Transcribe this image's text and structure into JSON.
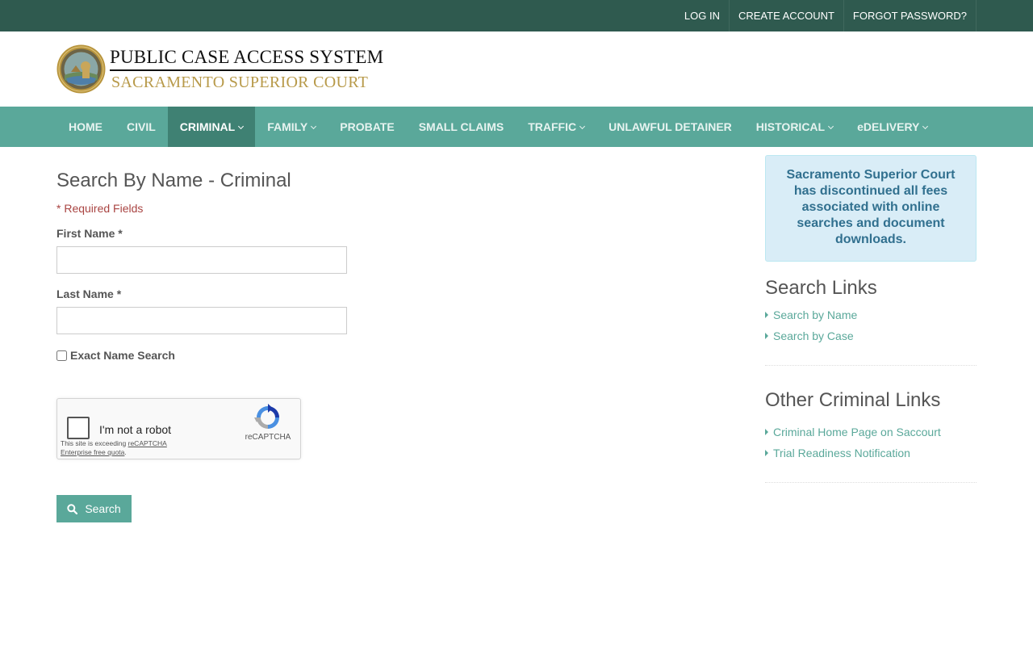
{
  "topbar": {
    "links": [
      "LOG IN",
      "CREATE ACCOUNT",
      "FORGOT PASSWORD?"
    ]
  },
  "header": {
    "title_line1": "PUBLIC CASE ACCESS SYSTEM",
    "title_line2": "SACRAMENTO SUPERIOR COURT"
  },
  "nav": {
    "items": [
      {
        "label": "HOME",
        "dropdown": false,
        "active": false
      },
      {
        "label": "CIVIL",
        "dropdown": false,
        "active": false
      },
      {
        "label": "CRIMINAL",
        "dropdown": true,
        "active": true
      },
      {
        "label": "FAMILY",
        "dropdown": true,
        "active": false
      },
      {
        "label": "PROBATE",
        "dropdown": false,
        "active": false
      },
      {
        "label": "SMALL CLAIMS",
        "dropdown": false,
        "active": false
      },
      {
        "label": "TRAFFIC",
        "dropdown": true,
        "active": false
      },
      {
        "label": "UNLAWFUL DETAINER",
        "dropdown": false,
        "active": false
      },
      {
        "label": "HISTORICAL",
        "dropdown": true,
        "active": false
      },
      {
        "label": "eDELIVERY",
        "dropdown": true,
        "active": false
      }
    ]
  },
  "form": {
    "title": "Search By Name - Criminal",
    "required_note": "* Required Fields",
    "first_name_label": "First Name *",
    "first_name_value": "",
    "last_name_label": "Last Name *",
    "last_name_value": "",
    "exact_label": "Exact Name Search",
    "exact_checked": false,
    "search_label": "Search"
  },
  "captcha": {
    "label": "I'm not a robot",
    "brand": "reCAPTCHA",
    "note_prefix": "This site is exceeding ",
    "note_link": "reCAPTCHA Enterprise free quota",
    "note_suffix": "."
  },
  "sidebar": {
    "notice": "Sacramento Superior Court has discontinued all fees associated with online searches and document downloads.",
    "search_heading": "Search Links",
    "search_links": [
      "Search by Name",
      "Search by Case"
    ],
    "other_heading": "Other Criminal Links",
    "other_links": [
      "Criminal Home Page on Saccourt",
      "Trial Readiness Notification"
    ]
  },
  "colors": {
    "topbar": "#2f5a4f",
    "nav": "#5aa89a",
    "nav_active": "#3f8173",
    "accent": "#5aa89a",
    "required": "#a94442",
    "notice_bg": "#d9edf7",
    "notice_text": "#31708f"
  },
  "icons": {
    "seal": "court-seal-icon",
    "search": "search-icon",
    "captcha": "recaptcha-icon"
  }
}
